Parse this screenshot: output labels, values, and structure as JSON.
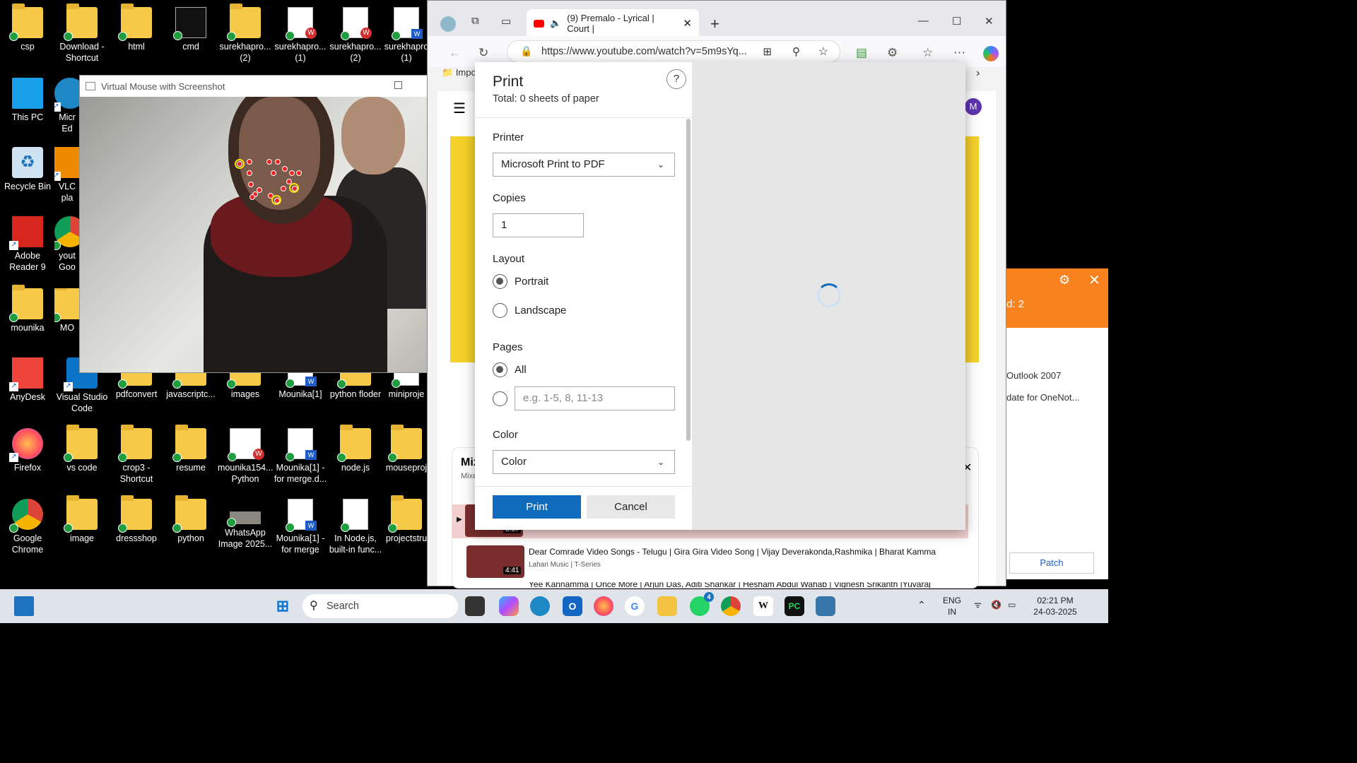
{
  "desktop": {
    "icons": [
      {
        "label": "csp"
      },
      {
        "label": "Download - Shortcut"
      },
      {
        "label": "html"
      },
      {
        "label": "cmd"
      },
      {
        "label": "surekhapro... (2)"
      },
      {
        "label": "surekhapro... (1)"
      },
      {
        "label": "surekhapro... (2)"
      },
      {
        "label": "surekhapro (1)"
      },
      {
        "label": "This PC"
      },
      {
        "label": "Micr Ed"
      },
      {
        "label": "Recycle Bin"
      },
      {
        "label": "VLC pla"
      },
      {
        "label": "Adobe Reader 9"
      },
      {
        "label": "yout Goo"
      },
      {
        "label": "mounika"
      },
      {
        "label": "MO"
      },
      {
        "label": "AnyDesk"
      },
      {
        "label": "Visual Studio Code"
      },
      {
        "label": "pdfconvert"
      },
      {
        "label": "javascriptc..."
      },
      {
        "label": "images"
      },
      {
        "label": "Mounika[1]"
      },
      {
        "label": "python floder"
      },
      {
        "label": "miniproje"
      },
      {
        "label": "Firefox"
      },
      {
        "label": "vs code"
      },
      {
        "label": "crop3 - Shortcut"
      },
      {
        "label": "resume"
      },
      {
        "label": "mounika154... Python"
      },
      {
        "label": "Mounika[1] - for merge.d..."
      },
      {
        "label": "node.js"
      },
      {
        "label": "mouseproj"
      },
      {
        "label": "Google Chrome"
      },
      {
        "label": "image"
      },
      {
        "label": "dressshop"
      },
      {
        "label": "python"
      },
      {
        "label": "WhatsApp Image 2025..."
      },
      {
        "label": "Mounika[1] - for merge"
      },
      {
        "label": "In Node.js, built-in func..."
      },
      {
        "label": "projectstru"
      }
    ]
  },
  "vm_window": {
    "title": "Virtual Mouse with Screenshot"
  },
  "browser": {
    "tab_title": "(9) Premalo - Lyrical | Court |",
    "url": "https://www.youtube.com/watch?v=5m9sYq...",
    "fav_item": "Impo",
    "mix_title": "Mix",
    "mix_sub": "Mixe",
    "videos": [
      {
        "title": "",
        "channel": "",
        "duration": "5:37"
      },
      {
        "title": "Dear Comrade Video Songs - Telugu | Gira Gira Video Song | Vijay Deverakonda,Rashmika | Bharat Kamma",
        "channel": "Lahari Music | T-Series",
        "duration": "4:41"
      },
      {
        "title": "Yee Kannamma | Once More | Arjun Das, Aditi Shankar | Hesham Abdul Wahab | Vignesh Srikanth |Yuvaraj",
        "channel": "",
        "duration": ""
      }
    ],
    "avatar_letter": "M"
  },
  "print": {
    "title": "Print",
    "subtitle": "Total: 0 sheets of paper",
    "help": "?",
    "printer_label": "Printer",
    "printer_value": "Microsoft Print to PDF",
    "copies_label": "Copies",
    "copies_value": "1",
    "layout_label": "Layout",
    "portrait": "Portrait",
    "landscape": "Landscape",
    "layout_selected": "Portrait",
    "pages_label": "Pages",
    "pages_all": "All",
    "pages_placeholder": "e.g. 1-5, 8, 11-13",
    "color_label": "Color",
    "color_value": "Color",
    "print_button": "Print",
    "cancel_button": "Cancel"
  },
  "side_panel": {
    "head_text": "d: 2",
    "row1": "Outlook 2007",
    "row2": "date for OneNot...",
    "patch_button": "Patch"
  },
  "taskbar": {
    "search_placeholder": "Search",
    "lang_top": "ENG",
    "lang_bottom": "IN",
    "time": "02:21 PM",
    "date": "24-03-2025",
    "whatsapp_badge": "4"
  },
  "colors": {
    "accent": "#0f6cbd",
    "youtube_red": "#ff0000",
    "orange": "#f7821e"
  }
}
